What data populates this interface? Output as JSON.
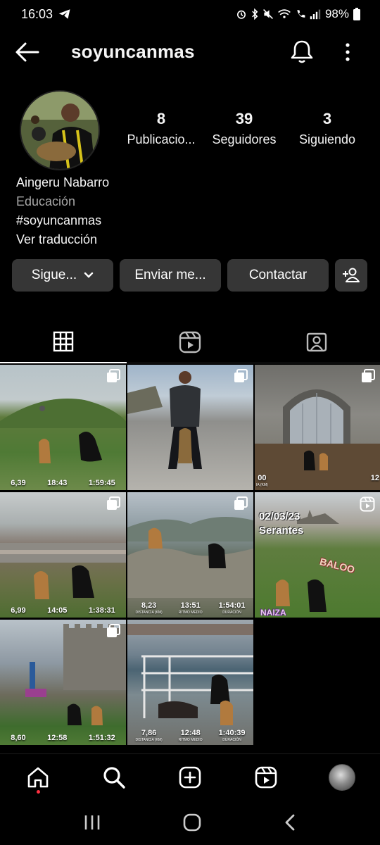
{
  "status_bar": {
    "time": "16:03",
    "battery": "98%"
  },
  "header": {
    "username": "soyuncanmas"
  },
  "profile": {
    "stats": [
      {
        "value": "8",
        "label": "Publicacio..."
      },
      {
        "value": "39",
        "label": "Seguidores"
      },
      {
        "value": "3",
        "label": "Siguiendo"
      }
    ],
    "name": "Aingeru Nabarro",
    "category": "Educación",
    "hashtag": "#soyuncanmas",
    "translate": "Ver traducción"
  },
  "actions": {
    "following": "Sigue...",
    "message": "Enviar me...",
    "contact": "Contactar"
  },
  "tabs": [
    "grid-icon",
    "reels-icon",
    "tagged-icon"
  ],
  "posts": [
    {
      "dist": "6,39",
      "pace": "18:43",
      "dur": "1:59:45",
      "type": "carousel"
    },
    {
      "type": "carousel"
    },
    {
      "dist": "00",
      "dist_sub": "IA (KM)",
      "dur": "12",
      "type": "carousel"
    },
    {
      "dist": "6,99",
      "pace": "14:05",
      "dur": "1:38:31",
      "type": "carousel"
    },
    {
      "dist": "8,23",
      "dist_sub": "DISTANCIA (KM)",
      "pace": "13:51",
      "pace_sub": "RITMO MEDIO",
      "dur": "1:54:01",
      "dur_sub": "DURACIÓN",
      "type": "carousel"
    },
    {
      "date": "02/03/23",
      "place": "Serantes",
      "tag1": "BALOO",
      "tag2": "NAIZA",
      "type": "reel"
    },
    {
      "dist": "8,60",
      "pace": "12:58",
      "dur": "1:51:32",
      "type": "carousel"
    },
    {
      "dist": "7,86",
      "dist_sub": "DISTANCIA (KM)",
      "pace": "12:48",
      "pace_sub": "RITMO MEDIO",
      "dur": "1:40:39",
      "dur_sub": "DURACIÓN",
      "type": "none"
    }
  ],
  "bottom_nav": [
    "home-icon",
    "search-icon",
    "create-icon",
    "reels-icon",
    "profile-avatar"
  ],
  "colors": {
    "background": "#000000",
    "button": "#363636",
    "muted_text": "#a8a8a8",
    "notification_dot": "#ff3040"
  }
}
